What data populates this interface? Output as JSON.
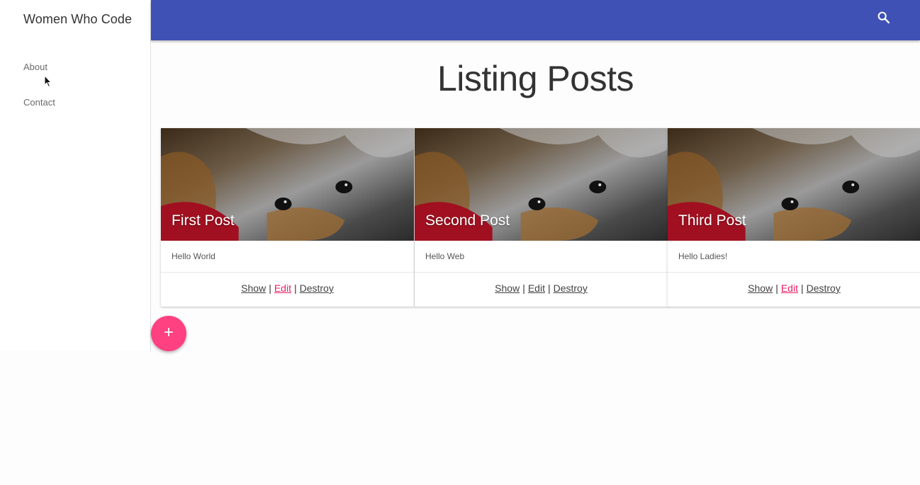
{
  "app": {
    "brand": "Women Who Code"
  },
  "sidebar": {
    "items": [
      {
        "label": "About"
      },
      {
        "label": "Contact"
      }
    ]
  },
  "topbar": {
    "search_icon": "search-icon",
    "color": "#3f51b5"
  },
  "main": {
    "title": "Listing Posts",
    "posts": [
      {
        "title": "First Post",
        "body": "Hello World",
        "actions": [
          "Show",
          "Edit",
          "Destroy"
        ]
      },
      {
        "title": "Second Post",
        "body": "Hello Web",
        "actions": [
          "Show",
          "Edit",
          "Destroy"
        ]
      },
      {
        "title": "Third Post",
        "body": "Hello Ladies!",
        "actions": [
          "Show",
          "Edit",
          "Destroy"
        ]
      }
    ],
    "action_separator": "|"
  },
  "fab": {
    "label": "+",
    "color": "#ff4081"
  },
  "colors": {
    "accent": "#e91e63",
    "primary": "#3f51b5"
  }
}
